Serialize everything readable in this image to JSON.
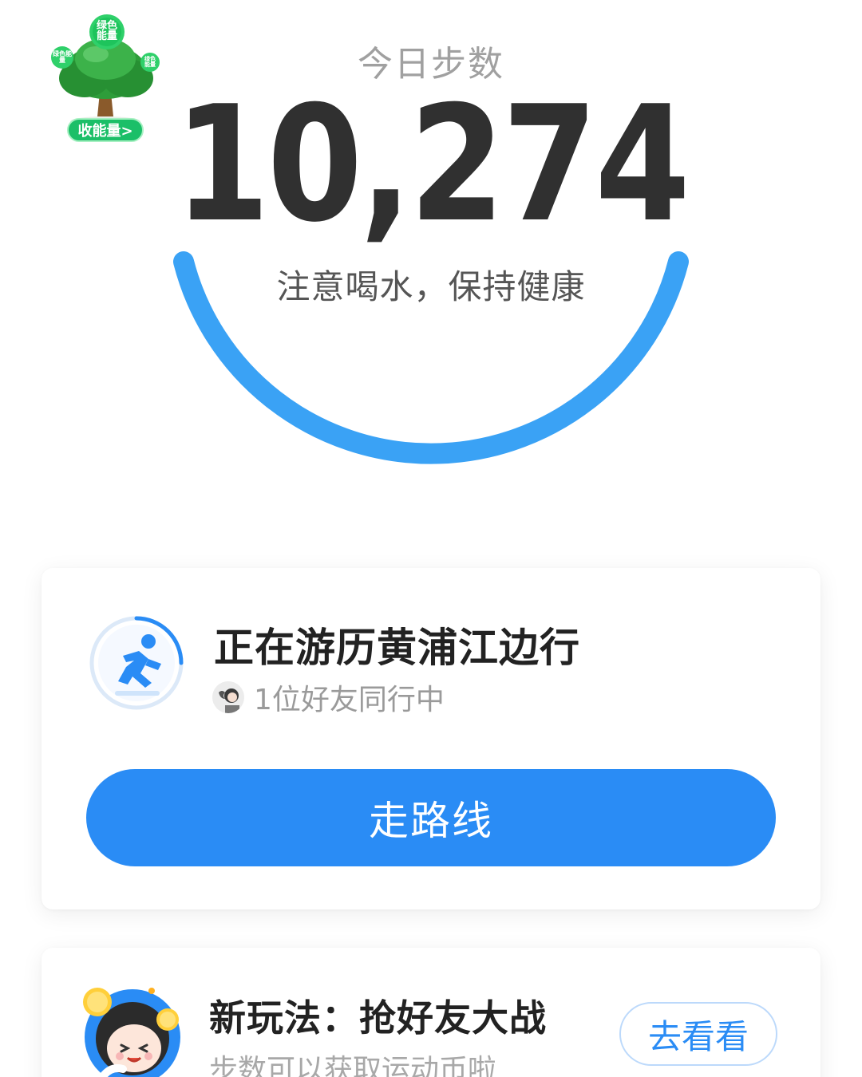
{
  "tree_widget": {
    "bubble_top": "绿色能量",
    "bubble_left": "绿色能量",
    "bubble_right": "绿色能量",
    "collect_label": "收能量>"
  },
  "steps": {
    "title": "今日步数",
    "count": "10,274",
    "tip": "注意喝水，保持健康",
    "progress_fraction": 1.0
  },
  "route_card": {
    "title": "正在游历黄浦江边行",
    "companions": "1位好友同行中",
    "button_label": "走路线",
    "icon": "running-person-icon"
  },
  "promo_card": {
    "title": "新玩法：抢好友大战",
    "subtitle": "步数可以获取运动币啦",
    "button_label": "去看看",
    "icon": "cartoon-girl-coins-icon"
  },
  "colors": {
    "accent_blue": "#2a8cf5",
    "arc_blue": "#3aa2f5",
    "tree_green": "#1bbf68",
    "title_gray": "#a0a0a0",
    "number_dark": "#303030"
  }
}
